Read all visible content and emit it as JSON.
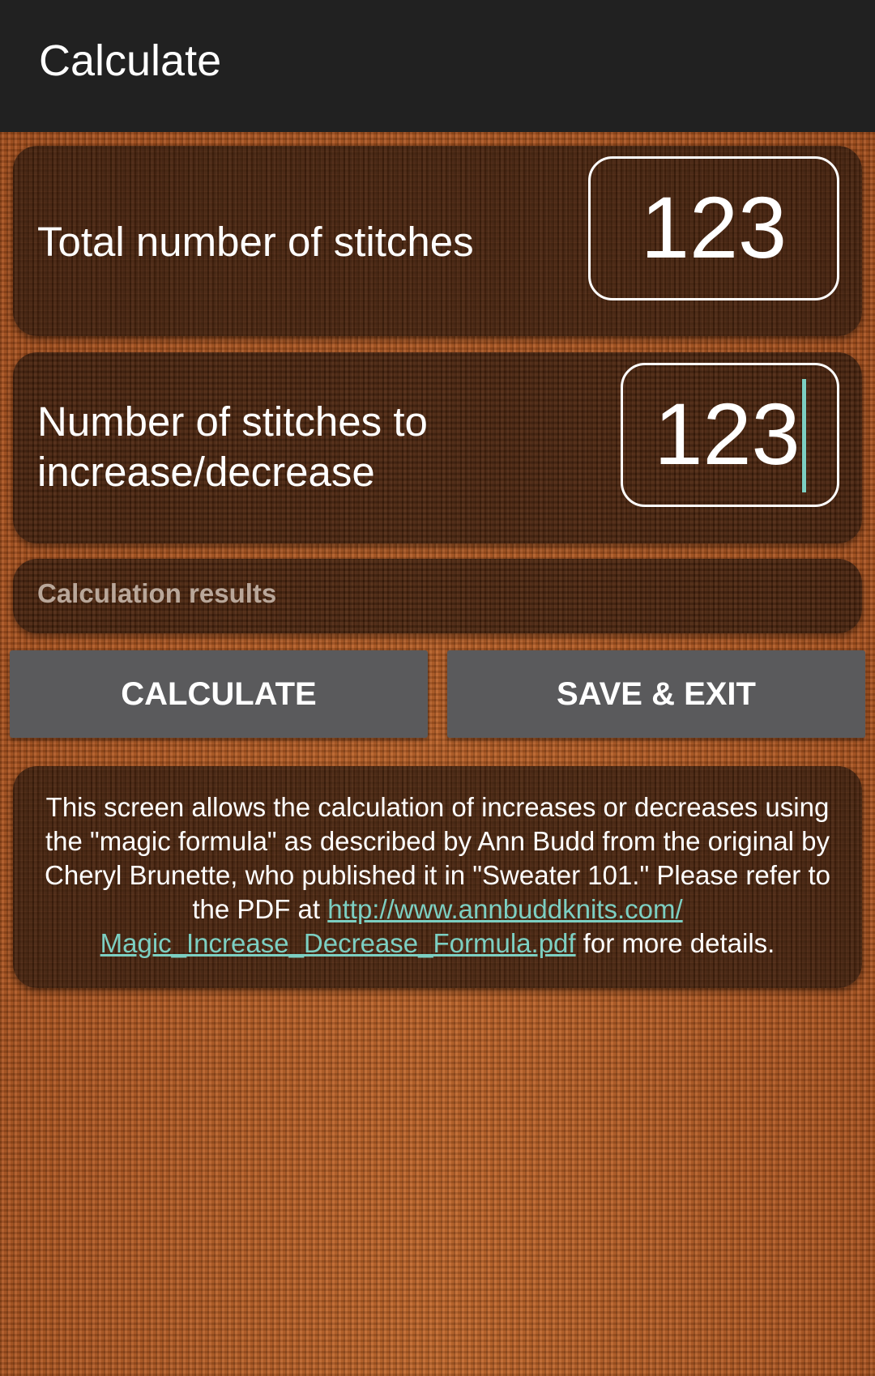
{
  "appbar": {
    "title": "Calculate"
  },
  "total_stitches": {
    "label": "Total number of stitches",
    "value": "123"
  },
  "change_stitches": {
    "label_line1": "Number of stitches to",
    "label_line2": "increase/decrease",
    "value": "123"
  },
  "results": {
    "placeholder": "Calculation results"
  },
  "buttons": {
    "calculate": "CALCULATE",
    "save_exit": "SAVE & EXIT"
  },
  "info": {
    "text_before": "This screen allows the calculation of increases or decreases using the \"magic formula\" as described by Ann Budd from the original by Cheryl Brunette, who published it in \"Sweater 101.\" Please refer to the PDF at ",
    "link_line1": "http://www.annbuddknits.com/",
    "link_line2": "Magic_Increase_Decrease_Formula.pdf",
    "text_after": " for more details."
  },
  "colors": {
    "appbar": "#212121",
    "accent": "#7ccfc2",
    "button": "#5a5a5c",
    "background": "#b65a22"
  }
}
